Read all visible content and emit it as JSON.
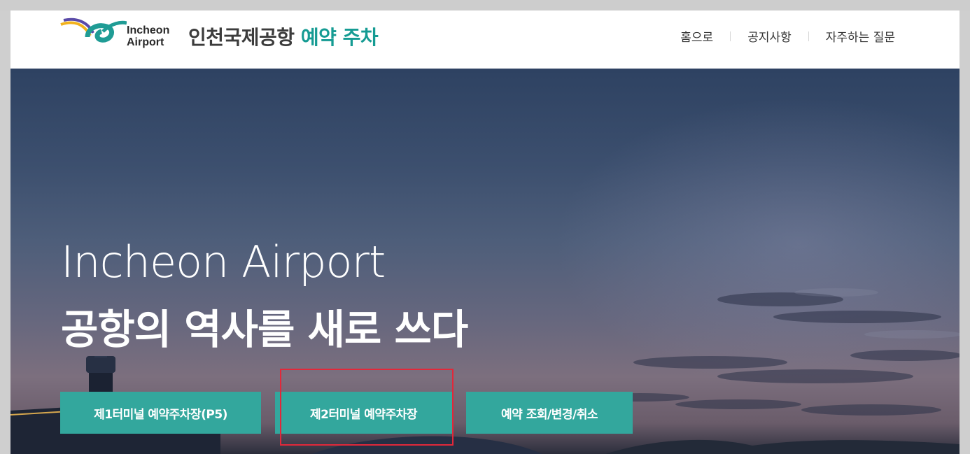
{
  "header": {
    "logo": {
      "line1": "Incheon",
      "line2": "Airport"
    },
    "brand": {
      "prefix": "인천국제공항",
      "accent": "예약 주차"
    },
    "nav": [
      {
        "label": "홈으로"
      },
      {
        "label": "공지사항"
      },
      {
        "label": "자주하는 질문"
      }
    ]
  },
  "hero": {
    "title_en": "Incheon Airport",
    "title_ko": "공항의 역사를 새로 쓰다"
  },
  "actions": [
    {
      "label": "제1터미널 예약주차장(P5)"
    },
    {
      "label": "제2터미널 예약주차장"
    },
    {
      "label": "예약 조회/변경/취소"
    }
  ],
  "colors": {
    "accent": "#159b93",
    "button": "#33a79d",
    "highlight": "#e2283a"
  }
}
